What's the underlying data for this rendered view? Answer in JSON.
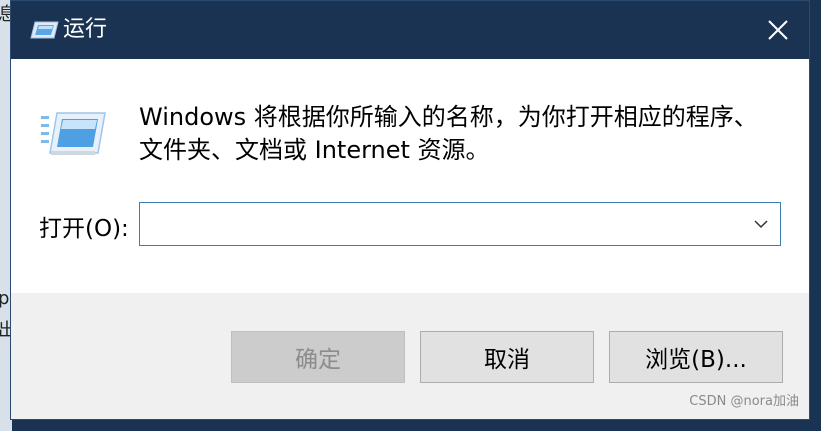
{
  "window": {
    "title": "运行",
    "close_icon": "close-icon"
  },
  "desktop": {
    "edge_chars": [
      "息",
      "p",
      "出"
    ]
  },
  "content": {
    "app_icon": "run-icon",
    "description": "Windows 将根据你所输入的名称，为你打开相应的程序、文件夹、文档或 Internet 资源。"
  },
  "open_field": {
    "label": "打开(O):",
    "value": "",
    "dropdown_icon": "chevron-down-icon"
  },
  "buttons": {
    "ok": "确定",
    "cancel": "取消",
    "browse": "浏览(B)..."
  },
  "watermark": "CSDN @nora加油"
}
